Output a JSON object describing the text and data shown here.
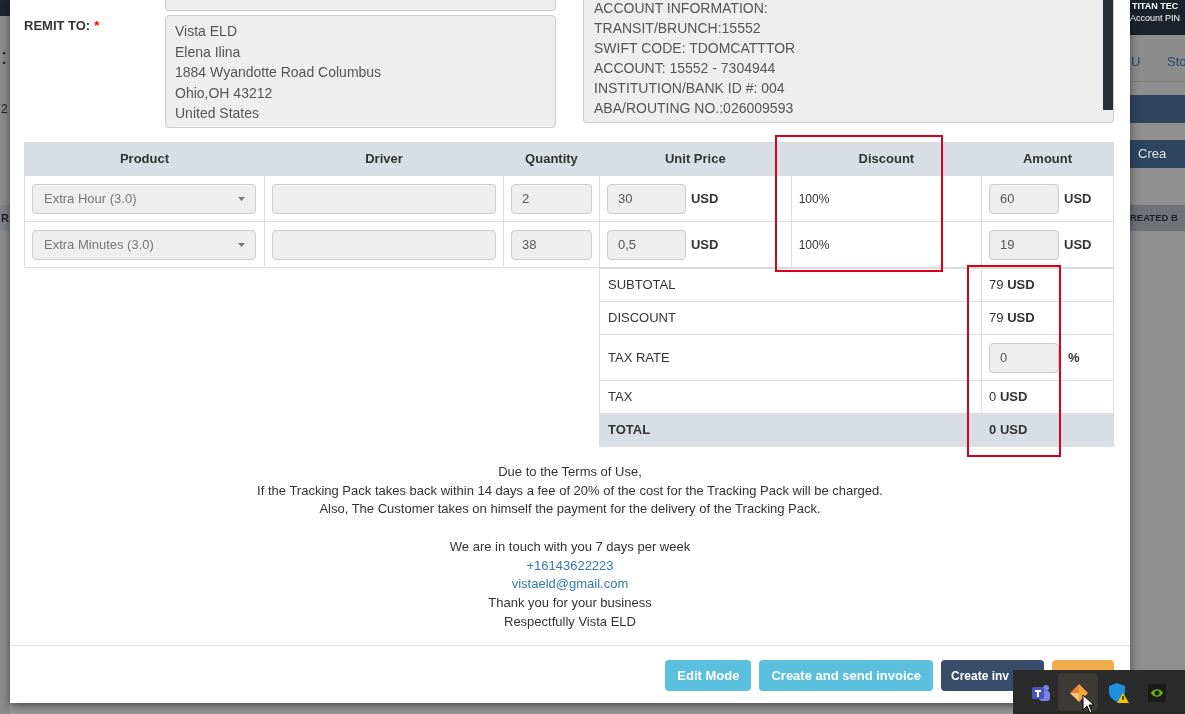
{
  "background": {
    "header_texts": [
      "TITAN TEC",
      "Account PIN"
    ],
    "nav_links": [
      "U",
      "Sto"
    ],
    "left_texts": [
      ":",
      "2",
      "R"
    ],
    "button": "Crea",
    "column_header": "REATED B"
  },
  "form": {
    "remit_label": "REMIT TO:",
    "required_mark": "*",
    "remit_lines": [
      "Vista ELD",
      "Elena Ilina",
      "1884 Wyandotte Road Columbus",
      "Ohio,OH 43212",
      "United States"
    ],
    "account_lines": [
      "ACCOUNT INFORMATION:",
      "TRANSIT/BRUNCH:15552",
      "SWIFT CODE: TDOMCATTTOR",
      "ACCOUNT: 15552 - 7304944",
      "INSTITUTION/BANK ID #: 004",
      "ABA/ROUTING NO.:026009593"
    ]
  },
  "table": {
    "columns": [
      "Product",
      "Driver",
      "Quantity",
      "Unit Price",
      "Discount",
      "Amount"
    ],
    "rows": [
      {
        "product": "Extra Hour (3.0)",
        "quantity": "2",
        "unit_price": "30",
        "price_currency": "USD",
        "discount": "100%",
        "amount": "60",
        "amount_currency": "USD"
      },
      {
        "product": "Extra Minutes (3.0)",
        "quantity": "38",
        "unit_price": "0,5",
        "price_currency": "USD",
        "discount": "100%",
        "amount": "19",
        "amount_currency": "USD"
      }
    ]
  },
  "summary": [
    {
      "kind": "text",
      "label": "SUBTOTAL",
      "value": "79",
      "unit": "USD"
    },
    {
      "kind": "text",
      "label": "DISCOUNT",
      "value": "79",
      "unit": "USD"
    },
    {
      "kind": "input",
      "label": "TAX RATE",
      "value": "0",
      "unit": "%"
    },
    {
      "kind": "text",
      "label": "TAX",
      "value": "0",
      "unit": "USD"
    },
    {
      "kind": "total",
      "label": "TOTAL",
      "value": "0",
      "unit": "USD"
    }
  ],
  "notes": {
    "terms": [
      "Due to the Terms of Use,",
      "If the Tracking Pack takes back within 14 days a fee of 20% of the cost for the Tracking Pack will be charged.",
      "Also, The Customer takes on himself the payment for the delivery of the Tracking Pack."
    ],
    "contact_heading": "We are in touch with you 7 days per week",
    "phone": "+16143622223",
    "email": "vistaeld@gmail.com",
    "closing": [
      "Thank you for your business",
      "Respectfully Vista ELD"
    ]
  },
  "buttons": [
    {
      "kind": "info",
      "label": "Edit Mode"
    },
    {
      "kind": "info",
      "label": "Create and send invoice"
    },
    {
      "kind": "primary",
      "label": "Create inv"
    },
    {
      "kind": "warning"
    }
  ]
}
